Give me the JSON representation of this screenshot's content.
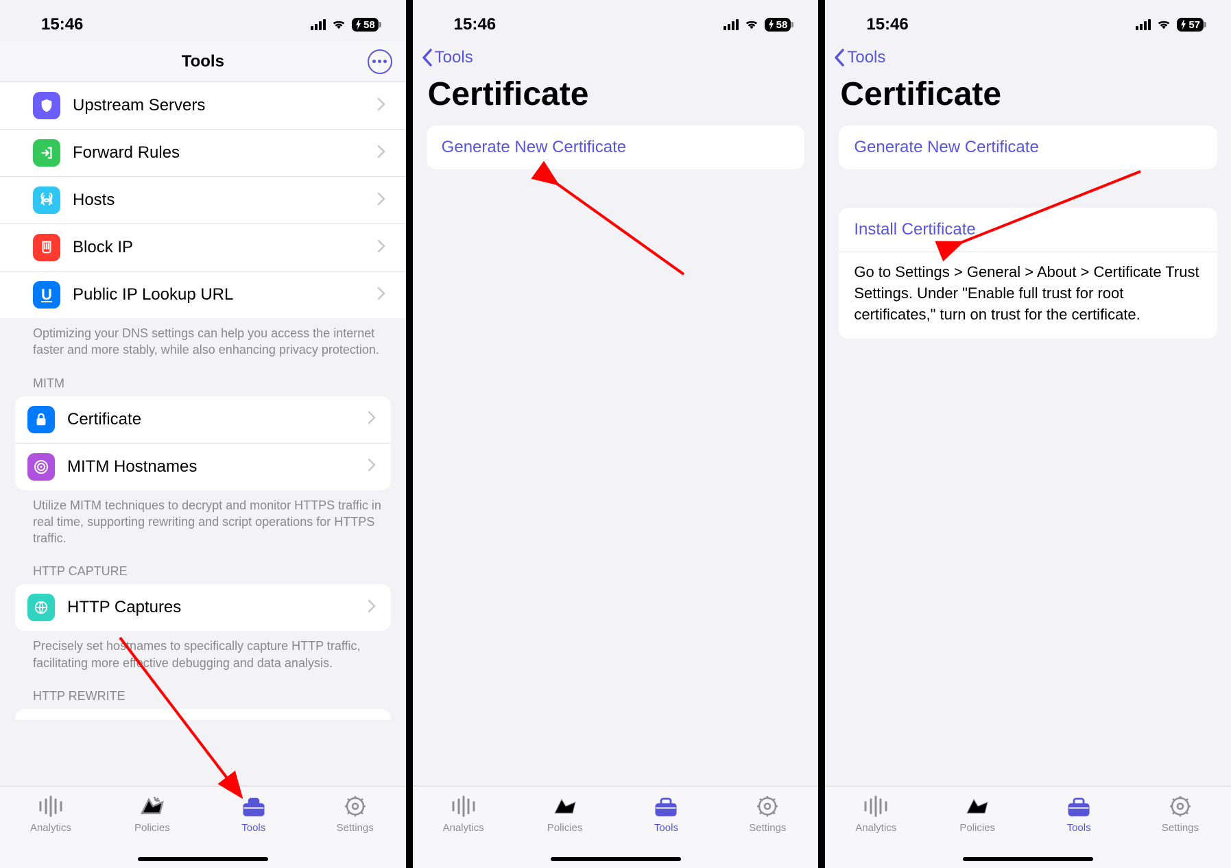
{
  "status": {
    "time": "15:46",
    "battery1": "58",
    "battery2": "58",
    "battery3": "57"
  },
  "screen1": {
    "title": "Tools",
    "rows_dns": [
      {
        "label": "Upstream Servers"
      },
      {
        "label": "Forward Rules"
      },
      {
        "label": "Hosts"
      },
      {
        "label": "Block IP"
      },
      {
        "label": "Public IP Lookup URL"
      }
    ],
    "dns_footer": "Optimizing your DNS settings can help you access the internet faster and more stably, while also enhancing privacy protection.",
    "mitm_header": "MITM",
    "rows_mitm": [
      {
        "label": "Certificate"
      },
      {
        "label": "MITM Hostnames"
      }
    ],
    "mitm_footer": "Utilize MITM techniques to decrypt and monitor HTTPS traffic in real time, supporting rewriting and script operations for HTTPS traffic.",
    "capture_header": "HTTP CAPTURE",
    "rows_capture": [
      {
        "label": "HTTP Captures"
      }
    ],
    "capture_footer": "Precisely set hostnames to specifically capture HTTP traffic, facilitating more effective debugging and data analysis.",
    "rewrite_header": "HTTP REWRITE"
  },
  "screen2": {
    "back": "Tools",
    "title": "Certificate",
    "link1": "Generate New Certificate"
  },
  "screen3": {
    "back": "Tools",
    "title": "Certificate",
    "link1": "Generate New Certificate",
    "link2": "Install Certificate",
    "info": "Go to Settings > General > About > Certificate Trust Settings. Under \"Enable full trust for root certificates,\" turn on trust for the certificate."
  },
  "tabs": [
    "Analytics",
    "Policies",
    "Tools",
    "Settings"
  ]
}
